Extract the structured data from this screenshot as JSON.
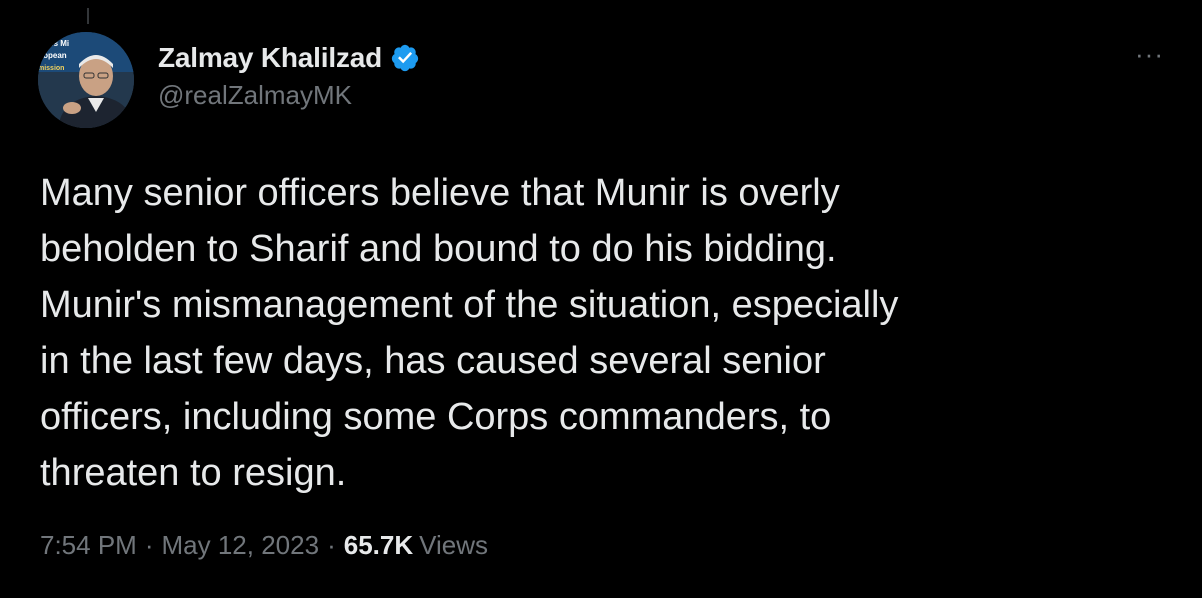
{
  "author": {
    "display_name": "Zalmay Khalilzad",
    "handle": "@realZalmayMK",
    "verified": true,
    "avatar_icon": "profile-photo",
    "avatar_backdrop_text": [
      "ates Mi",
      "ropean",
      "mission"
    ]
  },
  "menu": {
    "more_label": "···"
  },
  "tweet": {
    "text": "Many senior officers believe that Munir is overly\nbeholden to Sharif and bound to do his bidding.\nMunir's mismanagement of the situation, especially\nin the last few days, has caused several senior\nofficers, including some Corps commanders, to\nthreaten to resign."
  },
  "meta": {
    "time": "7:54 PM",
    "separator": "·",
    "date": "May 12, 2023",
    "views_count": "65.7K",
    "views_label": "Views"
  },
  "colors": {
    "background": "#000000",
    "primary_text": "#e7e9ea",
    "secondary_text": "#71767b",
    "verified_badge": "#1d9bf0"
  }
}
